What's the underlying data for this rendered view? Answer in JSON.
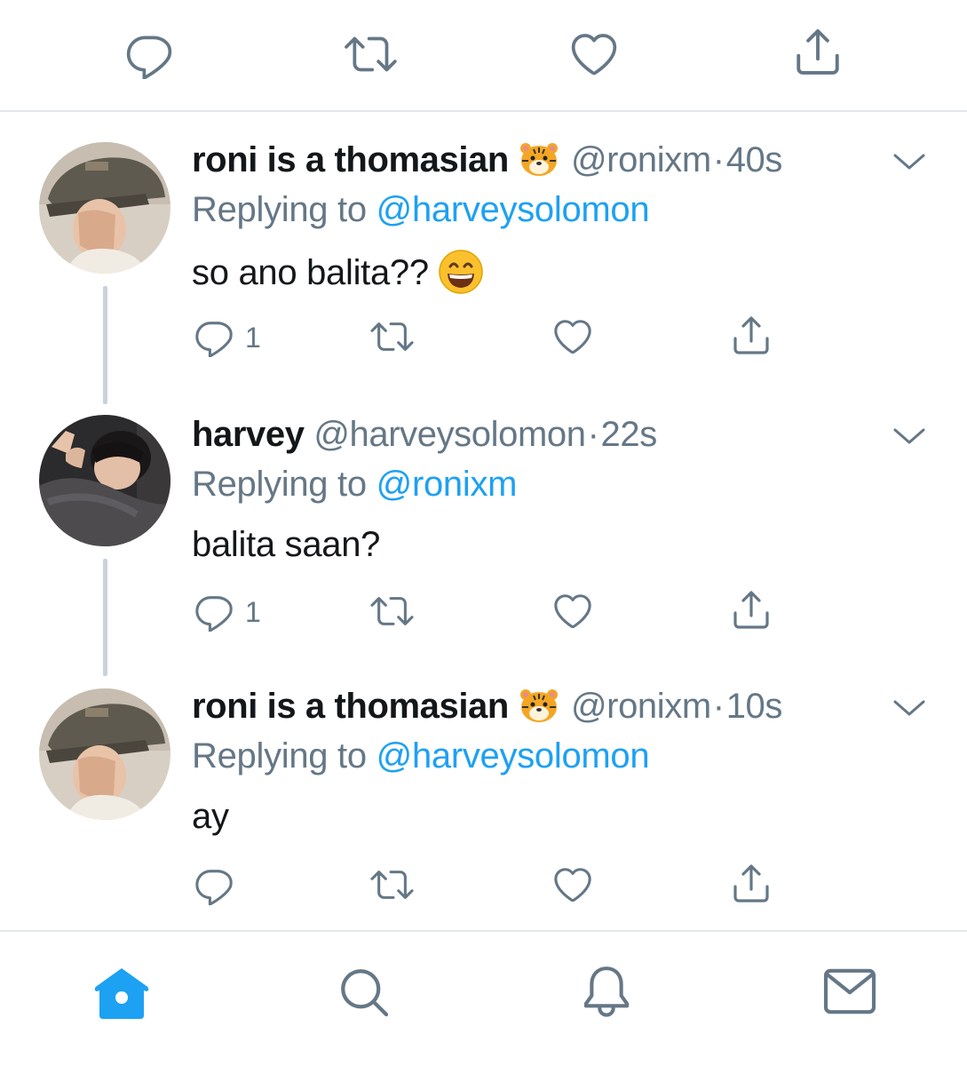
{
  "top_actions": {
    "icons": [
      "reply-icon",
      "retweet-icon",
      "like-icon",
      "share-icon"
    ]
  },
  "tweets": [
    {
      "display_name": "roni is a thomasian",
      "name_emoji": "🐯",
      "handle": "@ronixm",
      "separator": "·",
      "time": "40s",
      "replying_prefix": "Replying to ",
      "replying_to": "@harveysolomon",
      "text": "so ano balita??",
      "text_emoji": "😄",
      "reply_count": "1"
    },
    {
      "display_name": "harvey",
      "handle": "@harveysolomon",
      "separator": "·",
      "time": "22s",
      "replying_prefix": "Replying to ",
      "replying_to": "@ronixm",
      "text": "balita saan?",
      "reply_count": "1"
    },
    {
      "display_name": "roni is a thomasian",
      "name_emoji": "🐯",
      "handle": "@ronixm",
      "separator": "·",
      "time": "10s",
      "replying_prefix": "Replying to ",
      "replying_to": "@harveysolomon",
      "text": "ay",
      "reply_count": ""
    }
  ],
  "tab_bar": {
    "tabs": [
      "home-icon",
      "search-icon",
      "notifications-icon",
      "messages-icon"
    ],
    "active_tab": "home-icon"
  },
  "colors": {
    "accent": "#1da1f2",
    "icon_gray": "#657786",
    "text": "#14171a",
    "divider": "#e1e8ed",
    "thread_line": "#c8d2dc"
  }
}
